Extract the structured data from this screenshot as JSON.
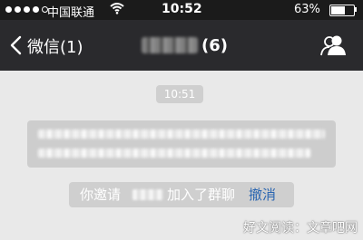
{
  "status_bar": {
    "carrier": "中国联通",
    "time": "10:52",
    "battery_percent_text": "63%",
    "battery_level": 0.63
  },
  "nav": {
    "back_label": "微信(1)",
    "title_count": "(6)"
  },
  "chat": {
    "timestamp": "10:51",
    "invite_prefix": "你邀请",
    "invite_suffix": "加入了群聊",
    "undo_label": "撤消"
  },
  "colors": {
    "navbar_bg": "#2a2a2d",
    "link": "#2b66b1",
    "chat_bg": "#e9e9e9"
  },
  "icons": {
    "wifi": "wifi-icon",
    "back": "chevron-left-icon",
    "contacts": "group-contacts-icon"
  },
  "watermark": "好文阅读：文章吧网"
}
